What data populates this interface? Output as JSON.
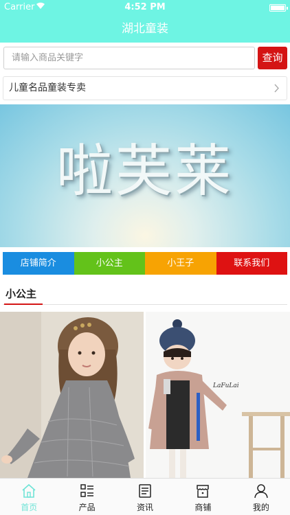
{
  "status_bar": {
    "carrier": "Carrier",
    "time": "4:52 PM"
  },
  "nav": {
    "title": "湖北童装"
  },
  "search": {
    "placeholder": "请输入商品关键字",
    "button": "查询"
  },
  "promo": {
    "text": "儿童名品童装专卖"
  },
  "banner": {
    "brand_text": "啦芙莱"
  },
  "categories": [
    {
      "label": "店铺简介",
      "color": "#1a8de0"
    },
    {
      "label": "小公主",
      "color": "#63c21a"
    },
    {
      "label": "小王子",
      "color": "#f7a303"
    },
    {
      "label": "联系我们",
      "color": "#de1212"
    }
  ],
  "section": {
    "title": "小公主"
  },
  "products": [
    {
      "image": "girl-in-gray-lace-dress-photo"
    },
    {
      "image": "girl-in-pink-coat-and-knit-hat-photo",
      "sign_text": "LaFuLai"
    }
  ],
  "tabs": [
    {
      "label": "首页",
      "icon": "home-icon",
      "active": true
    },
    {
      "label": "产品",
      "icon": "grid-list-icon",
      "active": false
    },
    {
      "label": "资讯",
      "icon": "news-icon",
      "active": false
    },
    {
      "label": "商铺",
      "icon": "store-icon",
      "active": false
    },
    {
      "label": "我的",
      "icon": "user-icon",
      "active": false
    }
  ],
  "colors": {
    "header": "#6ef4e3",
    "accent_red": "#d41414",
    "tab_active": "#6ee3d6"
  }
}
